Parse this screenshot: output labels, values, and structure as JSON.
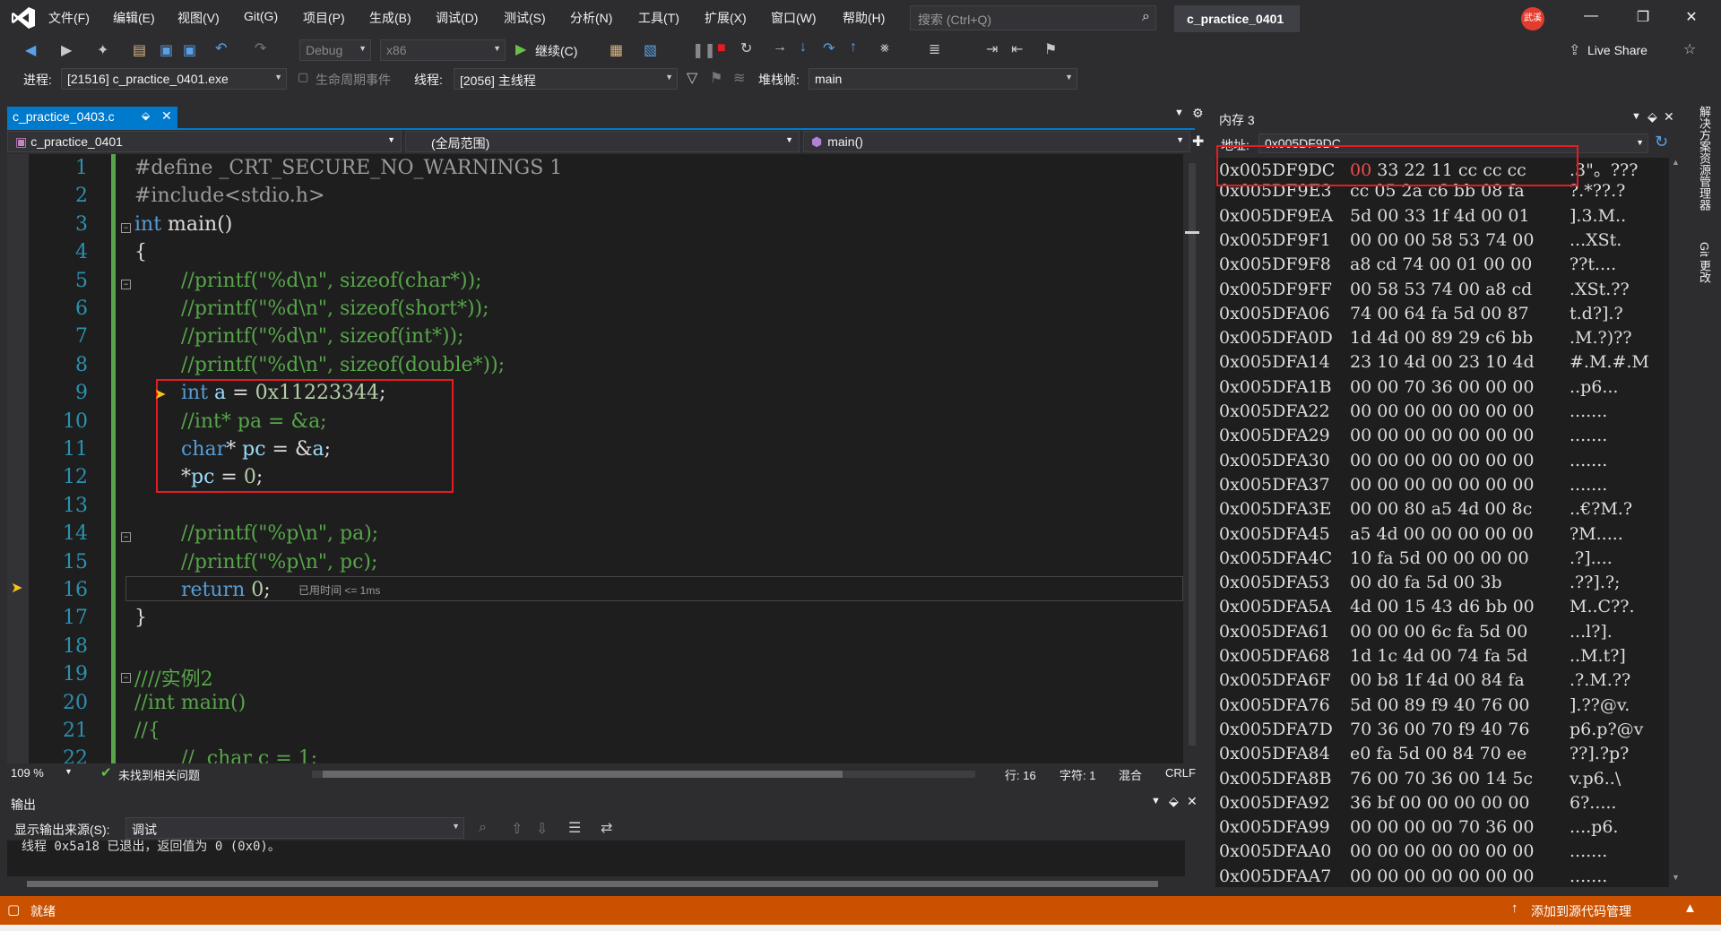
{
  "menu": [
    "文件(F)",
    "编辑(E)",
    "视图(V)",
    "Git(G)",
    "项目(P)",
    "生成(B)",
    "调试(D)",
    "测试(S)",
    "分析(N)",
    "工具(T)",
    "扩展(X)",
    "窗口(W)",
    "帮助(H)"
  ],
  "search": {
    "placeholder": "搜索 (Ctrl+Q)"
  },
  "window_title": "c_practice_0401",
  "user_badge": "武溪",
  "toolbar": {
    "config": "Debug",
    "platform": "x86",
    "continue_label": "继续(C)",
    "live_share": "Live Share",
    "process_label": "进程:",
    "process_value": "[21516] c_practice_0401.exe",
    "lifecycle_label": "生命周期事件",
    "thread_label": "线程:",
    "thread_value": "[2056] 主线程",
    "stack_label": "堆栈帧:",
    "stack_value": "main"
  },
  "editor": {
    "tab_title": "c_practice_0403.c",
    "nav_project": "c_practice_0401",
    "nav_scope": "(全局范围)",
    "nav_function": "main()",
    "elapsed_hint": "已用时间 <= 1ms",
    "lines": [
      "1",
      "2",
      "3",
      "4",
      "5",
      "6",
      "7",
      "8",
      "9",
      "10",
      "11",
      "12",
      "13",
      "14",
      "15",
      "16",
      "17",
      "18",
      "19",
      "20",
      "21",
      "22"
    ]
  },
  "editor_status": {
    "zoom": "109 %",
    "issues": "未找到相关问题",
    "row": "行: 16",
    "col": "字符: 1",
    "mode": "混合",
    "eol": "CRLF"
  },
  "output": {
    "title": "输出",
    "source_label": "显示输出来源(S):",
    "source_value": "调试",
    "text": "线程 0x5a18 已退出，返回值为 0 (0x0)。"
  },
  "memory": {
    "title": "内存 3",
    "addr_label": "地址:",
    "addr_value": "0x005DF9DC",
    "rows": [
      {
        "addr": "0x005DF9DC",
        "bytes": "00 33 22 11 cc cc cc",
        "ascii": ".3\"。???"
      },
      {
        "addr": "0x005DF9E3",
        "bytes": "cc 05 2a c6 bb 08 fa",
        "ascii": "?.*??.?"
      },
      {
        "addr": "0x005DF9EA",
        "bytes": "5d 00 33 1f 4d 00 01",
        "ascii": "].3.M.."
      },
      {
        "addr": "0x005DF9F1",
        "bytes": "00 00 00 58 53 74 00",
        "ascii": "...XSt."
      },
      {
        "addr": "0x005DF9F8",
        "bytes": "a8 cd 74 00 01 00 00",
        "ascii": "??t...."
      },
      {
        "addr": "0x005DF9FF",
        "bytes": "00 58 53 74 00 a8 cd",
        "ascii": ".XSt.??"
      },
      {
        "addr": "0x005DFA06",
        "bytes": "74 00 64 fa 5d 00 87",
        "ascii": "t.d?].?"
      },
      {
        "addr": "0x005DFA0D",
        "bytes": "1d 4d 00 89 29 c6 bb",
        "ascii": ".M.?)??"
      },
      {
        "addr": "0x005DFA14",
        "bytes": "23 10 4d 00 23 10 4d",
        "ascii": "#.M.#.M"
      },
      {
        "addr": "0x005DFA1B",
        "bytes": "00 00 70 36 00 00 00",
        "ascii": "..p6..."
      },
      {
        "addr": "0x005DFA22",
        "bytes": "00 00 00 00 00 00 00",
        "ascii": "......."
      },
      {
        "addr": "0x005DFA29",
        "bytes": "00 00 00 00 00 00 00",
        "ascii": "......."
      },
      {
        "addr": "0x005DFA30",
        "bytes": "00 00 00 00 00 00 00",
        "ascii": "......."
      },
      {
        "addr": "0x005DFA37",
        "bytes": "00 00 00 00 00 00 00",
        "ascii": "......."
      },
      {
        "addr": "0x005DFA3E",
        "bytes": "00 00 80 a5 4d 00 8c",
        "ascii": "..€?M.?"
      },
      {
        "addr": "0x005DFA45",
        "bytes": "a5 4d 00 00 00 00 00",
        "ascii": "?M....."
      },
      {
        "addr": "0x005DFA4C",
        "bytes": "10 fa 5d 00 00 00 00",
        "ascii": ".?]...."
      },
      {
        "addr": "0x005DFA53",
        "bytes": "00 d0 fa 5d 00 3b",
        "ascii": ".??].?;"
      },
      {
        "addr": "0x005DFA5A",
        "bytes": "4d 00 15 43 d6 bb 00",
        "ascii": "M..C??."
      },
      {
        "addr": "0x005DFA61",
        "bytes": "00 00 00 6c fa 5d 00",
        "ascii": "...l?]."
      },
      {
        "addr": "0x005DFA68",
        "bytes": "1d 1c 4d 00 74 fa 5d",
        "ascii": "..M.t?]"
      },
      {
        "addr": "0x005DFA6F",
        "bytes": "00 b8 1f 4d 00 84 fa",
        "ascii": ".?.M.??"
      },
      {
        "addr": "0x005DFA76",
        "bytes": "5d 00 89 f9 40 76 00",
        "ascii": "].??@v."
      },
      {
        "addr": "0x005DFA7D",
        "bytes": "70 36 00 70 f9 40 76",
        "ascii": "p6.p?@v"
      },
      {
        "addr": "0x005DFA84",
        "bytes": "e0 fa 5d 00 84 70 ee",
        "ascii": "??].?p?"
      },
      {
        "addr": "0x005DFA8B",
        "bytes": "76 00 70 36 00 14 5c",
        "ascii": "v.p6..\\"
      },
      {
        "addr": "0x005DFA92",
        "bytes": "36 bf 00 00 00 00 00",
        "ascii": "6?....."
      },
      {
        "addr": "0x005DFA99",
        "bytes": "00 00 00 00 70 36 00",
        "ascii": "....p6."
      },
      {
        "addr": "0x005DFAA0",
        "bytes": "00 00 00 00 00 00 00",
        "ascii": "......."
      },
      {
        "addr": "0x005DFAA7",
        "bytes": "00 00 00 00 00 00 00",
        "ascii": "......."
      }
    ]
  },
  "side_tabs": [
    "解决方案资源管理器",
    "Git 更改"
  ],
  "statusbar": {
    "ready": "就绪",
    "source_control": "添加到源代码管理"
  },
  "colors": {
    "accent": "#007acc",
    "status": "#ca5100",
    "highlight": "#e51c23"
  }
}
